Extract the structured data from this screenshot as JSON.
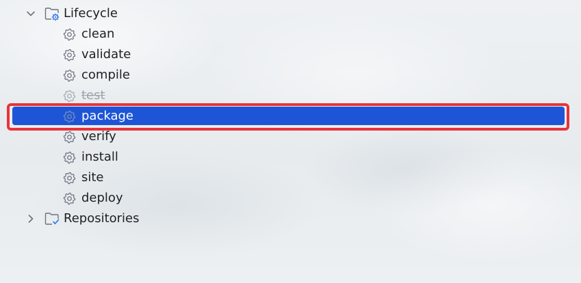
{
  "tree": {
    "lifecycle": {
      "label": "Lifecycle",
      "expanded": true,
      "icon": "lifecycle-folder-icon",
      "phases": [
        {
          "label": "clean",
          "icon": "gear-icon",
          "state": "normal"
        },
        {
          "label": "validate",
          "icon": "gear-icon",
          "state": "normal"
        },
        {
          "label": "compile",
          "icon": "gear-icon",
          "state": "normal"
        },
        {
          "label": "test",
          "icon": "gear-icon",
          "state": "skipped"
        },
        {
          "label": "package",
          "icon": "gear-icon",
          "state": "selected"
        },
        {
          "label": "verify",
          "icon": "gear-icon",
          "state": "normal"
        },
        {
          "label": "install",
          "icon": "gear-icon",
          "state": "normal"
        },
        {
          "label": "site",
          "icon": "gear-icon",
          "state": "normal"
        },
        {
          "label": "deploy",
          "icon": "gear-icon",
          "state": "normal"
        }
      ]
    },
    "repositories": {
      "label": "Repositories",
      "expanded": false,
      "icon": "repositories-folder-icon"
    }
  },
  "colors": {
    "selection": "#1d55d6",
    "annotation_outline": "#e7333a",
    "skipped_text": "#9ea3a8",
    "icon_stroke": "#6c707e",
    "folder_badge": "#3574f0"
  }
}
